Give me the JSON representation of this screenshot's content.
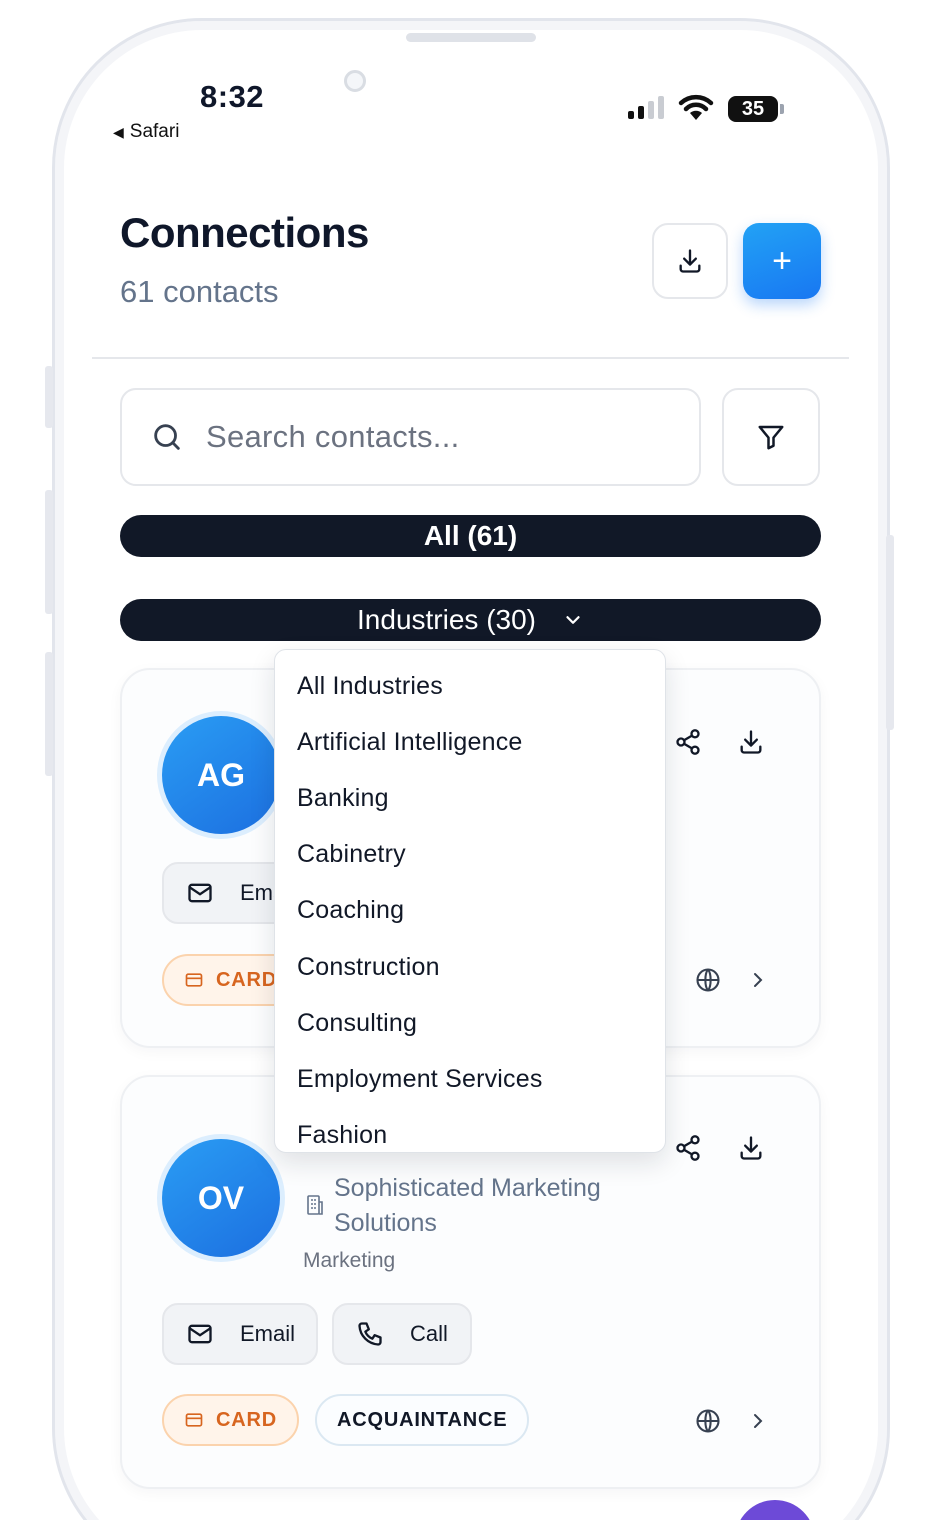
{
  "status_bar": {
    "time": "8:32",
    "back_app": "Safari",
    "battery_level": "35"
  },
  "header": {
    "title": "Connections",
    "subtitle": "61 contacts",
    "export_icon": "download-icon",
    "add_label": "+"
  },
  "search": {
    "placeholder": "Search contacts...",
    "icon": "search-icon",
    "filter_icon": "filter-icon"
  },
  "filters": {
    "all_label": "All (61)",
    "industries_label": "Industries (30)",
    "industries_icon": "chevron-down-icon"
  },
  "industry_dropdown": {
    "options": [
      "All Industries",
      "Artificial Intelligence",
      "Banking",
      "Cabinetry",
      "Coaching",
      "Construction",
      "Consulting",
      "Employment Services",
      "Fashion"
    ]
  },
  "contacts": [
    {
      "initials": "AG",
      "email_label": "Email",
      "card_label": "CARD"
    },
    {
      "initials": "OV",
      "company": "Sophisticated Marketing Solutions",
      "company_line1": "Sophisticated Marketing",
      "company_line2": "Solutions",
      "industry": "Marketing",
      "email_label": "Email",
      "call_label": "Call",
      "card_label": "CARD",
      "relationship": "ACQUAINTANCE"
    }
  ],
  "colors": {
    "accent_blue": "#1877f2",
    "pill_dark": "#111827",
    "card_tag_orange": "#d7651f",
    "muted_text": "#64748b"
  }
}
